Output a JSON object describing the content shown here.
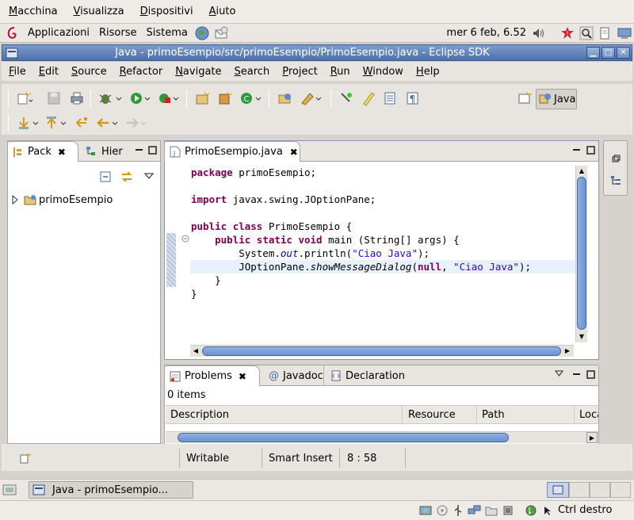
{
  "vbox_menu": [
    "Macchina",
    "Visualizza",
    "Dispositivi",
    "Aiuto"
  ],
  "gnome_panel": {
    "items": [
      "Applicazioni",
      "Risorse",
      "Sistema"
    ],
    "clock": "mer  6 feb, 6.52"
  },
  "window": {
    "title": "Java - primoEsempio/src/primoEsempio/PrimoEsempio.java - Eclipse SDK"
  },
  "menu": [
    "File",
    "Edit",
    "Source",
    "Refactor",
    "Navigate",
    "Search",
    "Project",
    "Run",
    "Window",
    "Help"
  ],
  "perspective": {
    "label": "Java"
  },
  "left_view": {
    "tabs": [
      "Pack",
      "Hier"
    ],
    "tree": [
      {
        "label": "primoEsempio"
      }
    ]
  },
  "editor": {
    "tab": "PrimoEsempio.java",
    "lines": [
      [
        {
          "t": "package ",
          "c": "kw"
        },
        {
          "t": "primoEsempio;",
          "c": ""
        }
      ],
      [],
      [
        {
          "t": "import ",
          "c": "kw"
        },
        {
          "t": "javax.swing.JOptionPane;",
          "c": ""
        }
      ],
      [],
      [
        {
          "t": "public ",
          "c": "kw"
        },
        {
          "t": "class ",
          "c": "kw"
        },
        {
          "t": "PrimoEsempio {",
          "c": ""
        }
      ],
      [
        {
          "t": "    ",
          "c": ""
        },
        {
          "t": "public ",
          "c": "kw"
        },
        {
          "t": "static ",
          "c": "kw"
        },
        {
          "t": "void ",
          "c": "kw"
        },
        {
          "t": "main (String[] args) {",
          "c": ""
        }
      ],
      [
        {
          "t": "        System.",
          "c": ""
        },
        {
          "t": "out",
          "c": "itf"
        },
        {
          "t": ".println(",
          "c": ""
        },
        {
          "t": "\"Ciao Java\"",
          "c": "str"
        },
        {
          "t": ");",
          "c": ""
        }
      ],
      [
        {
          "t": "        JOptionPane.",
          "c": ""
        },
        {
          "t": "showMessageDialog",
          "c": "it"
        },
        {
          "t": "(",
          "c": ""
        },
        {
          "t": "null",
          "c": "kw"
        },
        {
          "t": ", ",
          "c": ""
        },
        {
          "t": "\"Ciao Java\"",
          "c": "str"
        },
        {
          "t": ");",
          "c": ""
        }
      ],
      [
        {
          "t": "    }",
          "c": ""
        }
      ],
      [
        {
          "t": "}",
          "c": ""
        }
      ]
    ]
  },
  "bottom_view": {
    "tabs": [
      "Problems",
      "Javadoc",
      "Declaration"
    ],
    "items_count": "0 items",
    "columns": [
      "Description",
      "Resource",
      "Path",
      "Loca"
    ]
  },
  "status": {
    "writable": "Writable",
    "insert_mode": "Smart Insert",
    "position": "8 : 58"
  },
  "taskbar": {
    "task": "Java - primoEsempio..."
  },
  "vbox_status": {
    "host_key": "Ctrl destro"
  },
  "colors": {
    "keyword": "#7f0055",
    "string": "#2a00ff",
    "field": "#0000c0",
    "titlebar": "#5b7cb7",
    "current_line": "#e8f2fe"
  }
}
